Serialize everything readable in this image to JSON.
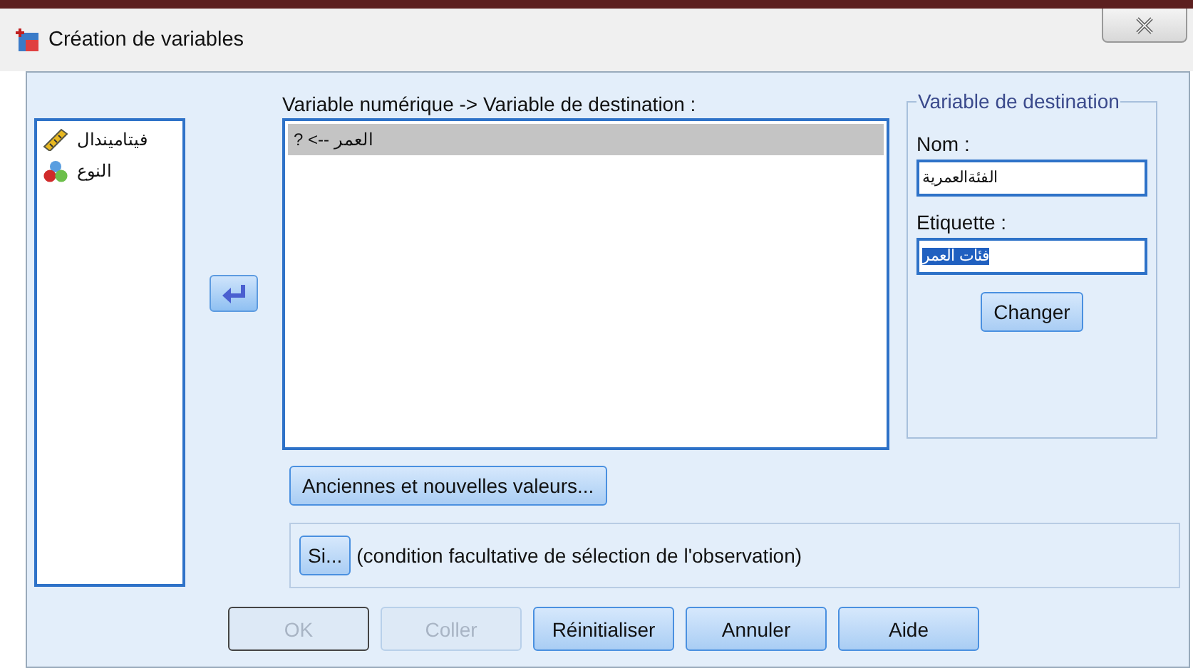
{
  "window": {
    "title": "Création de variables"
  },
  "source_variables": [
    {
      "name": "فيتاميندال",
      "kind": "scale"
    },
    {
      "name": "النوع",
      "kind": "nominal"
    }
  ],
  "mapping": {
    "label": "Variable numérique -> Variable de destination :",
    "rows": [
      {
        "text": "العمر --> ?",
        "selected": true
      }
    ]
  },
  "destination": {
    "legend": "Variable de destination",
    "name_label": "Nom :",
    "name_value": "الفئةالعمرية",
    "label_label": "Etiquette :",
    "label_value": "فئات العمر",
    "label_value_selected": true,
    "change_button": "Changer"
  },
  "old_new_button": "Anciennes et nouvelles valeurs...",
  "if_row": {
    "button": "Si...",
    "text": "(condition facultative de sélection de l'observation)"
  },
  "buttons": [
    {
      "label": "OK",
      "disabled": true,
      "default": true
    },
    {
      "label": "Coller",
      "disabled": true,
      "default": false
    },
    {
      "label": "Réinitialiser",
      "disabled": false,
      "default": false
    },
    {
      "label": "Annuler",
      "disabled": false,
      "default": false
    },
    {
      "label": "Aide",
      "disabled": false,
      "default": false
    }
  ]
}
